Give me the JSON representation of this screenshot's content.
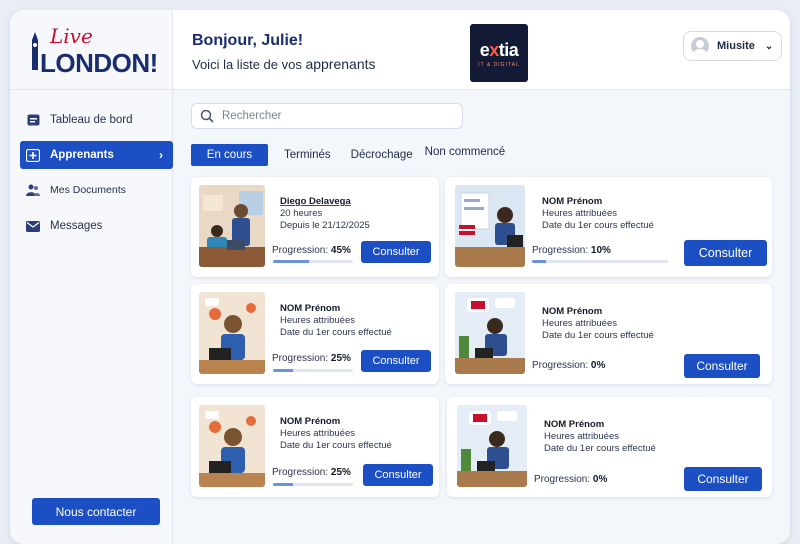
{
  "logo": {
    "top": "Live",
    "bottom": "LONDON!"
  },
  "sidebar": {
    "items": [
      {
        "label": "Tableau de bord",
        "icon": "dashboard-icon"
      },
      {
        "label": "Apprenants",
        "icon": "add-user-icon"
      },
      {
        "label": "Mes Documents",
        "icon": "people-icon"
      },
      {
        "label": "Messages",
        "icon": "mail-icon"
      }
    ],
    "contact_label": "Nous contacter"
  },
  "header": {
    "greeting": "Bonjour, Julie!",
    "subtitle_pre": "Voici la liste de vos ",
    "subtitle_em": "apprenants",
    "brand_name_a": "e",
    "brand_name_x": "x",
    "brand_name_b": "tia",
    "brand_tagline": "IT & DIGITAL",
    "user_name": "Miusite"
  },
  "search": {
    "placeholder": "Rechercher"
  },
  "tabs": [
    {
      "label": "En cours",
      "active": true
    },
    {
      "label": "Terminés",
      "active": false
    },
    {
      "label": "Décrochage",
      "active": false
    },
    {
      "label": "Non commencé",
      "active": false
    }
  ],
  "cards": [
    {
      "name": "Diego Delavega",
      "hours": "20 heures",
      "date": "Depuis le 21/12/2025",
      "progress_label": "Progression:",
      "progress_value": "45%",
      "progress": 0.45,
      "button": "Consulter"
    },
    {
      "name": "NOM Prénom",
      "hours": "Heures attribuées",
      "date": "Date du 1er cours effectué",
      "progress_label": "Progression:",
      "progress_value": "10%",
      "progress": 0.1,
      "button": "Consulter"
    },
    {
      "name": "NOM Prénom",
      "hours": "Heures attribuées",
      "date": "Date du 1er cours effectué",
      "progress_label": "Progression:",
      "progress_value": "25%",
      "progress": 0.25,
      "button": "Consulter"
    },
    {
      "name": "NOM Prénom",
      "hours": "Heures attribuées",
      "date": "Date du 1er cours effectué",
      "progress_label": "Progression:",
      "progress_value": "0%",
      "progress": 0.0,
      "button": "Consulter"
    },
    {
      "name": "NOM Prénom",
      "hours": "Heures attribuées",
      "date": "Date du 1er cours effectué",
      "progress_label": "Progression:",
      "progress_value": "25%",
      "progress": 0.25,
      "button": "Consulter"
    },
    {
      "name": "NOM Prénom",
      "hours": "Heures attribuées",
      "date": "Date du 1er cours effectué",
      "progress_label": "Progression:",
      "progress_value": "0%",
      "progress": 0.0,
      "button": "Consulter"
    }
  ],
  "colors": {
    "primary": "#1d4fc4",
    "brand_dark": "#131a36",
    "accent_red": "#c8102e"
  }
}
